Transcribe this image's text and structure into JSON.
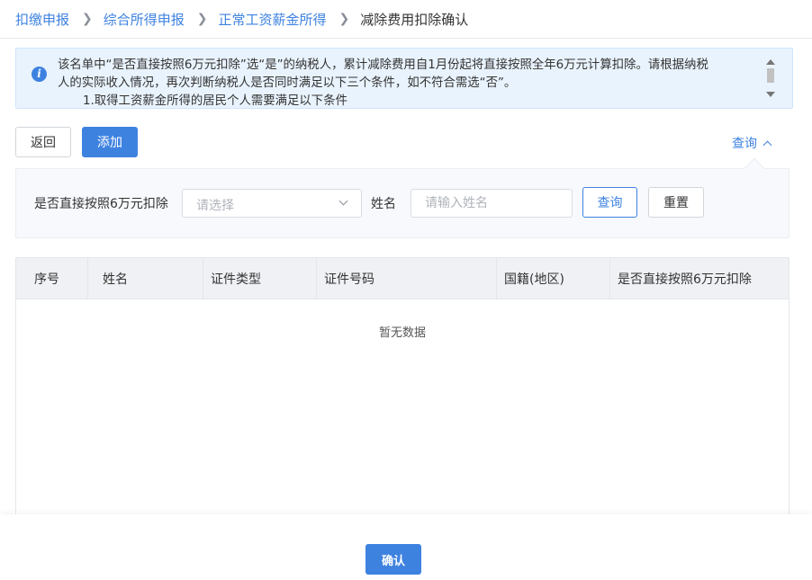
{
  "breadcrumb": {
    "items": [
      "扣缴申报",
      "综合所得申报",
      "正常工资薪金所得"
    ],
    "current": "减除费用扣除确认"
  },
  "notice": {
    "line1": "该名单中“是否直接按照6万元扣除”选“是”的纳税人，累计减除费用自1月份起将直接按照全年6万元计算扣除。请根据纳税",
    "line2": "人的实际收入情况，再次判断纳税人是否同时满足以下三个条件，如不符合需选“否”。",
    "line3": "1.取得工资薪金所得的居民个人需要满足以下条件"
  },
  "toolbar": {
    "back_label": "返回",
    "add_label": "添加",
    "toggle_query_label": "查询"
  },
  "filter": {
    "deduct_label": "是否直接按照6万元扣除",
    "deduct_placeholder": "请选择",
    "name_label": "姓名",
    "name_placeholder": "请输入姓名",
    "search_label": "查询",
    "reset_label": "重置"
  },
  "table": {
    "columns": [
      "序号",
      "姓名",
      "证件类型",
      "证件号码",
      "国籍(地区)",
      "是否直接按照6万元扣除"
    ],
    "empty_text": "暂无数据"
  },
  "footer": {
    "confirm_label": "确认"
  },
  "colors": {
    "accent": "#3e82e0",
    "notice_bg": "#e9f3fd"
  }
}
